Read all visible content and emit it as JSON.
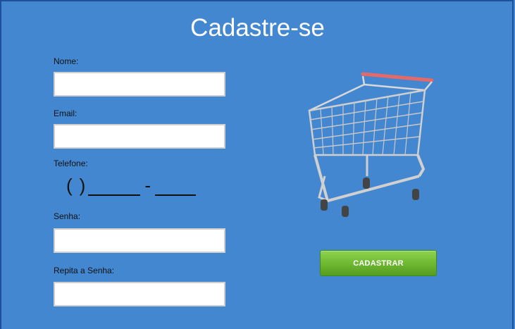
{
  "title": "Cadastre-se",
  "form": {
    "nome_label": "Nome:",
    "nome_value": "",
    "email_label": "Email:",
    "email_value": "",
    "telefone_label": "Telefone:",
    "telefone_open": "(",
    "telefone_close": ")",
    "telefone_dash": "-",
    "senha_label": "Senha:",
    "senha_value": "",
    "repita_label": "Repita a Senha:",
    "repita_value": ""
  },
  "submit_label": "CADASTRAR",
  "image": {
    "icon": "shopping-cart-icon"
  },
  "colors": {
    "background": "#4387d0",
    "button": "#6fb933",
    "cart_handle": "#e46a6a"
  }
}
